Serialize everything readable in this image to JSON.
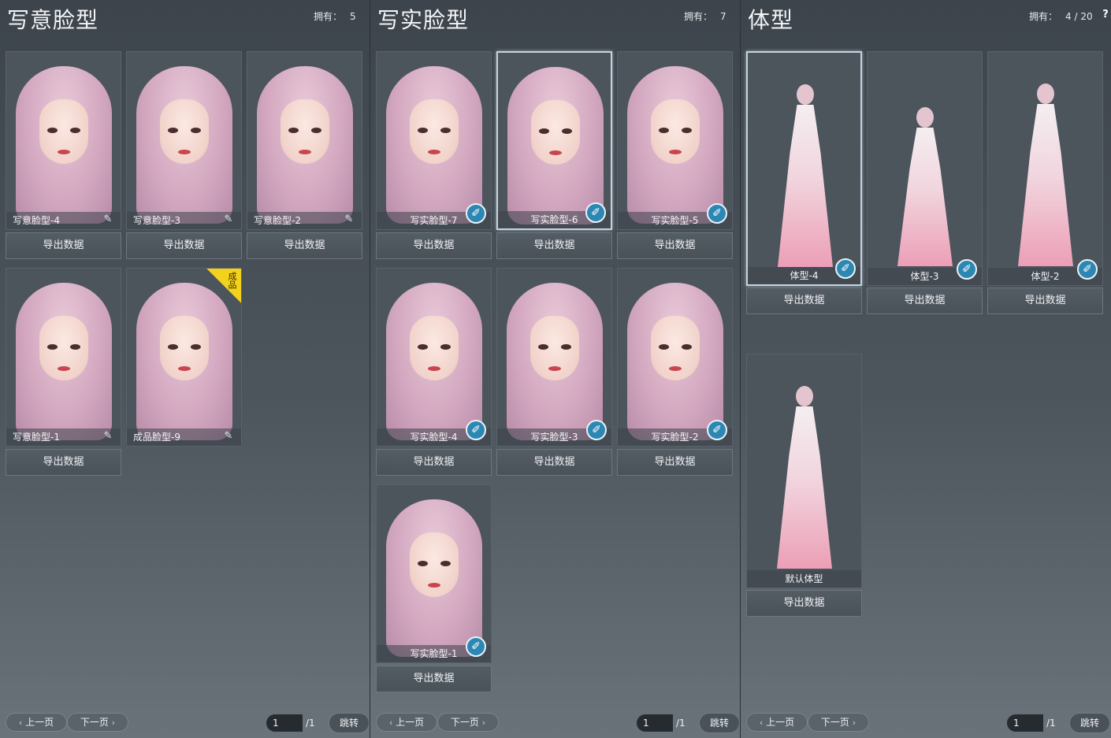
{
  "panels": {
    "stylized": {
      "title": "写意脸型",
      "owned_label": "拥有：",
      "owned_value": "5",
      "cards": [
        {
          "label": "写意脸型-4",
          "button": "导出数据"
        },
        {
          "label": "写意脸型-3",
          "button": "导出数据"
        },
        {
          "label": "写意脸型-2",
          "button": "导出数据"
        },
        {
          "label": "写意脸型-1",
          "button": "导出数据"
        },
        {
          "label": "成品脸型-9",
          "button": "导出数据",
          "badge": "成品"
        }
      ]
    },
    "realistic": {
      "title": "写实脸型",
      "owned_label": "拥有：",
      "owned_value": "7",
      "cards": [
        {
          "label": "写实脸型-7",
          "button": "导出数据"
        },
        {
          "label": "写实脸型-6",
          "button": "导出数据"
        },
        {
          "label": "写实脸型-5",
          "button": "导出数据"
        },
        {
          "label": "写实脸型-4",
          "button": "导出数据"
        },
        {
          "label": "写实脸型-3",
          "button": "导出数据"
        },
        {
          "label": "写实脸型-2",
          "button": "导出数据"
        },
        {
          "label": "写实脸型-1",
          "button": "导出数据"
        }
      ]
    },
    "body": {
      "title": "体型",
      "owned_label": "拥有：",
      "owned_value": "4 / 20",
      "help": "?",
      "cards": [
        {
          "label": "体型-4",
          "button": "导出数据"
        },
        {
          "label": "体型-3",
          "button": "导出数据"
        },
        {
          "label": "体型-2",
          "button": "导出数据"
        },
        {
          "label": "默认体型",
          "button": "导出数据"
        }
      ]
    }
  },
  "pager": {
    "prev": "上一页",
    "next": "下一页",
    "page_value": "1",
    "total": "/1",
    "jump": "跳转"
  },
  "icons": {
    "edit": "pen-icon",
    "brush": "brush-icon",
    "prev": "chevron-left-icon",
    "next": "chevron-right-icon"
  }
}
